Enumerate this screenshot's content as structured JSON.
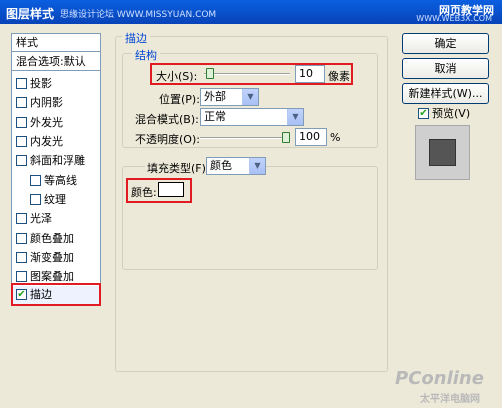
{
  "titlebar": {
    "title": "图层样式",
    "watermark_left": "思缘设计论坛 WWW.MISSYUAN.COM",
    "watermark_right": "网页教学网",
    "watermark_right_sub": "WWW.WEB3X.COM"
  },
  "sidebar": {
    "header": "样式",
    "blend_options": "混合选项:默认",
    "items": [
      {
        "label": "投影",
        "checked": false
      },
      {
        "label": "内阴影",
        "checked": false
      },
      {
        "label": "外发光",
        "checked": false
      },
      {
        "label": "内发光",
        "checked": false
      },
      {
        "label": "斜面和浮雕",
        "checked": false
      },
      {
        "label": "等高线",
        "checked": false
      },
      {
        "label": "纹理",
        "checked": false
      },
      {
        "label": "光泽",
        "checked": false
      },
      {
        "label": "颜色叠加",
        "checked": false
      },
      {
        "label": "渐变叠加",
        "checked": false
      },
      {
        "label": "图案叠加",
        "checked": false
      },
      {
        "label": "描边",
        "checked": true
      }
    ]
  },
  "stroke": {
    "group_title": "描边",
    "structure_title": "结构",
    "size_label": "大小(S):",
    "size_value": "10",
    "size_unit": "像素",
    "size_slider_fraction": 0.02,
    "position_label": "位置(P):",
    "position_value": "外部",
    "blend_mode_label": "混合模式(B):",
    "blend_mode_value": "正常",
    "opacity_label": "不透明度(O):",
    "opacity_value": "100",
    "opacity_unit": "%",
    "opacity_slider_fraction": 1.0,
    "fill_type_label": "填充类型(F):",
    "fill_type_value": "颜色",
    "color_label": "颜色:",
    "color_value": "#FFFFFF"
  },
  "buttons": {
    "ok": "确定",
    "cancel": "取消",
    "new_style": "新建样式(W)...",
    "preview_label": "预览(V)",
    "preview_checked": true
  },
  "watermark": {
    "brand": "PConline",
    "sub": "太平洋电脑网"
  }
}
